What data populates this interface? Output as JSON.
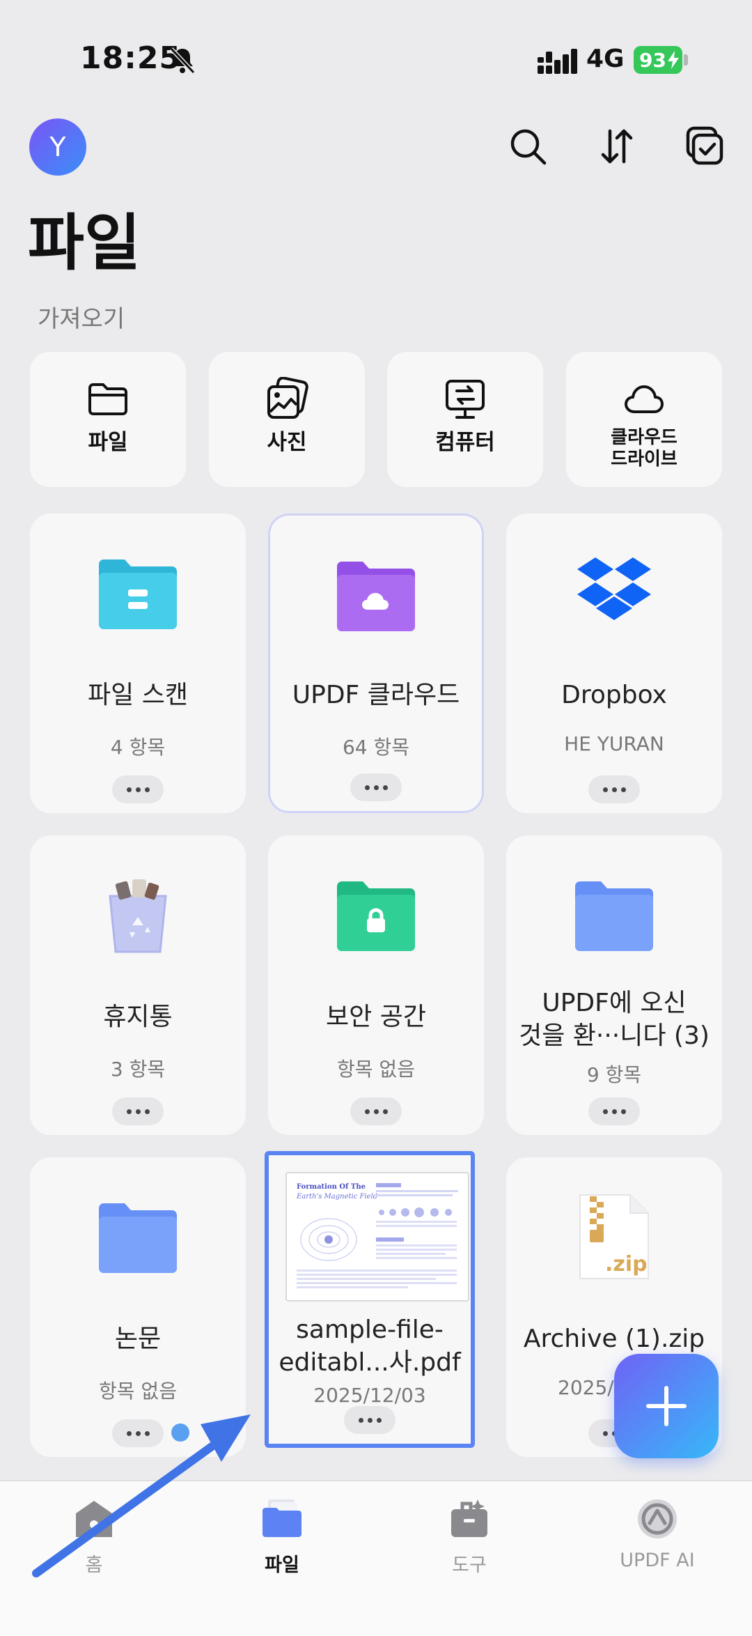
{
  "status": {
    "time": "18:25",
    "network": "4G",
    "battery": "93"
  },
  "header": {
    "avatar_letter": "Y",
    "title": "파일"
  },
  "import": {
    "section_label": "가져오기",
    "items": [
      {
        "label": "파일"
      },
      {
        "label": "사진"
      },
      {
        "label": "컴퓨터"
      },
      {
        "label_line1": "클라우드",
        "label_line2": "드라이브"
      }
    ]
  },
  "grid": [
    {
      "title": "파일 스캔",
      "sub": "4 항목"
    },
    {
      "title": "UPDF 클라우드",
      "sub": "64 항목"
    },
    {
      "title": "Dropbox",
      "sub": "HE YURAN"
    },
    {
      "title": "휴지통",
      "sub": "3 항목"
    },
    {
      "title": "보안 공간",
      "sub": "항목 없음"
    },
    {
      "title_line1": "UPDF에 오신",
      "title_line2": "것을 환···니다 (3)",
      "sub": "9 항목"
    },
    {
      "title": "논문",
      "sub": "항목 없음"
    },
    {
      "title_line1": "sample-file-",
      "title_line2": "editabl...사.pdf",
      "sub": "2025/12/03",
      "thumb": {
        "heading1": "Formation Of The",
        "heading2": "Earth's Magnetic Field"
      }
    },
    {
      "title": "Archive (1).zip",
      "sub": "2025/",
      "zip_badge": ".zip"
    }
  ],
  "tabs": [
    {
      "label": "홈"
    },
    {
      "label": "파일"
    },
    {
      "label": "도구"
    },
    {
      "label": "UPDF AI"
    }
  ],
  "colors": {
    "accent": "#5b84f3",
    "fab_start": "#6f63f6",
    "fab_end": "#37b8f8",
    "folder_scan": "#3dc6e6",
    "folder_cloud": "#a764ee",
    "folder_secure": "#2fcf96",
    "folder_default": "#7aa2fa",
    "dropbox": "#0f63f5",
    "battery": "#35c759"
  }
}
